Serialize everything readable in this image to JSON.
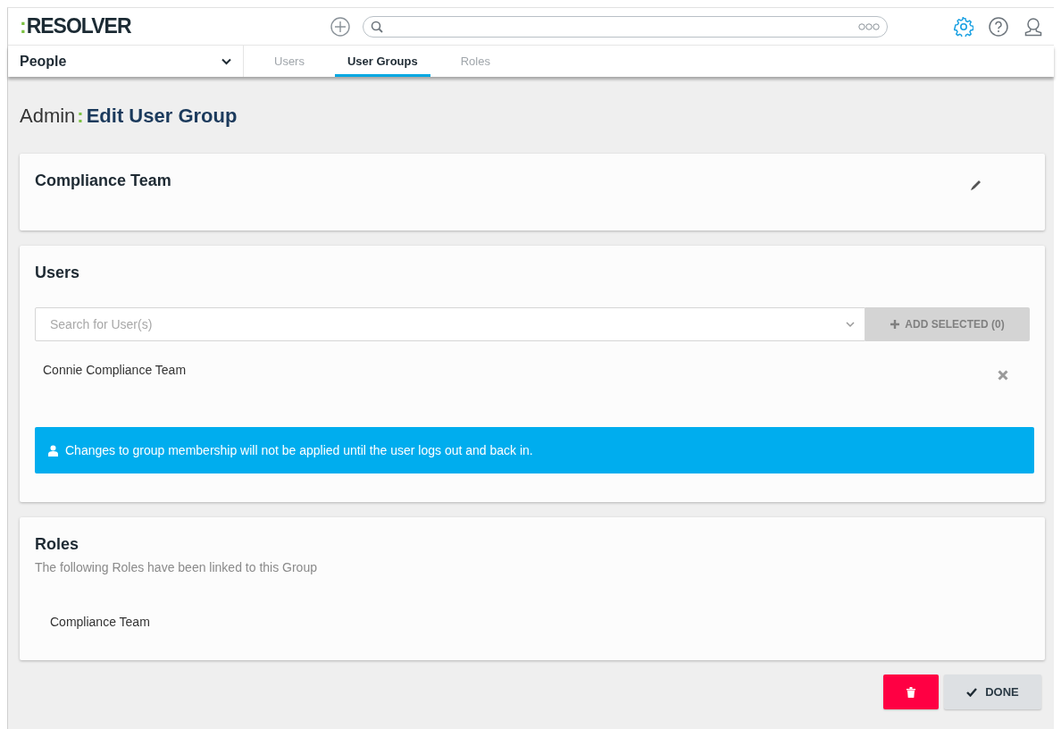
{
  "header": {
    "logo": {
      "mark": ":",
      "text": "RESOLVER"
    }
  },
  "nav": {
    "module": "People",
    "tabs": [
      {
        "label": "Users",
        "selected": false
      },
      {
        "label": "User Groups",
        "selected": true
      },
      {
        "label": "Roles",
        "selected": false
      }
    ]
  },
  "breadcrumb": {
    "parent": "Admin",
    "separator": ":",
    "current": "Edit User Group"
  },
  "group_card": {
    "name": "Compliance Team"
  },
  "users_card": {
    "title": "Users",
    "search": {
      "placeholder": "Search for User(s)"
    },
    "add_button": {
      "label": "ADD SELECTED (0)",
      "disabled": true
    },
    "members": [
      "Connie Compliance Team"
    ],
    "alert": "Changes to group membership will not be applied until the user logs out and back in."
  },
  "roles_card": {
    "title": "Roles",
    "subtitle": "The following Roles have been linked to this Group",
    "roles": [
      "Compliance Team"
    ]
  },
  "actions": {
    "done": "DONE"
  }
}
